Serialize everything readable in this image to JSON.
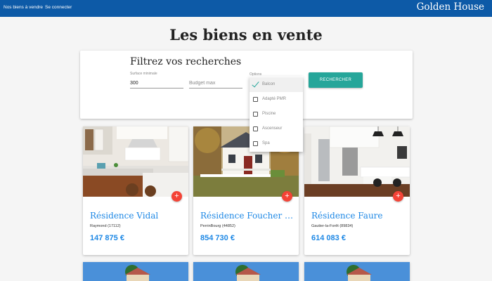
{
  "nav": {
    "items": [
      {
        "label": "Nos biens à vendre"
      },
      {
        "label": "Se connecter"
      }
    ],
    "brand": "Golden House"
  },
  "page_title": "Les biens en vente",
  "filter": {
    "title": "Filtrez vos recherches",
    "surface_label": "Surface minimale",
    "surface_value": "300",
    "budget_placeholder": "Budget max",
    "options_label": "Options",
    "search_button": "RECHERCHER",
    "options": [
      {
        "label": "Balcon",
        "checked": true
      },
      {
        "label": "Adapté PMR",
        "checked": false
      },
      {
        "label": "Piscine",
        "checked": false
      },
      {
        "label": "Ascenseur",
        "checked": false
      },
      {
        "label": "Spa",
        "checked": false
      }
    ]
  },
  "listings": [
    {
      "title": "Résidence Vidal",
      "location": "Raymond (17112)",
      "price": "147 875 €",
      "image": "kitchen-photo"
    },
    {
      "title": "Résidence Foucher Te...",
      "location": "PerrinBourg (44852)",
      "price": "854 730 €",
      "image": "house-photo"
    },
    {
      "title": "Résidence Faure",
      "location": "Gautier-la-Forêt (89834)",
      "price": "614 083 €",
      "image": "kitchen-photo"
    }
  ],
  "add_button_label": "+",
  "colors": {
    "nav_bg": "#0d5aa7",
    "accent_teal": "#26a69a",
    "fab_red": "#f44336",
    "link_blue": "#1e88e5"
  }
}
